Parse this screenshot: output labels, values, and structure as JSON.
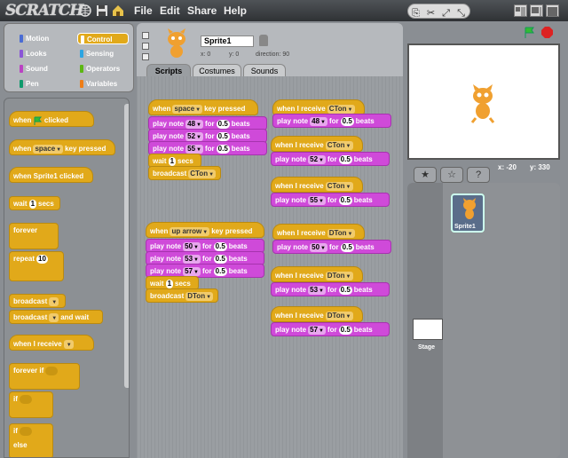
{
  "app": {
    "logo": "SCRATCH",
    "menus": [
      "File",
      "Edit",
      "Share",
      "Help"
    ]
  },
  "categories": [
    {
      "label": "Motion",
      "color": "#4a6cd4"
    },
    {
      "label": "Control",
      "color": "#e1a91a"
    },
    {
      "label": "Looks",
      "color": "#8a55d7"
    },
    {
      "label": "Sensing",
      "color": "#2ca5e2"
    },
    {
      "label": "Sound",
      "color": "#bb42c3"
    },
    {
      "label": "Operators",
      "color": "#5cb712"
    },
    {
      "label": "Pen",
      "color": "#0e9a6c"
    },
    {
      "label": "Variables",
      "color": "#ee7d16"
    }
  ],
  "palette": {
    "when_flag": [
      "when",
      "clicked"
    ],
    "when_key": [
      "when",
      "space",
      "key pressed"
    ],
    "when_sprite": "when Sprite1 clicked",
    "wait": [
      "wait",
      "1",
      "secs"
    ],
    "forever": "forever",
    "repeat": [
      "repeat",
      "10"
    ],
    "broadcast": "broadcast",
    "broadcast_wait": [
      "broadcast",
      "and wait"
    ],
    "when_receive": "when I receive",
    "forever_if": "forever if",
    "if": "if",
    "if2": "if",
    "else": "else"
  },
  "sprite": {
    "name": "Sprite1",
    "x_label": "x:",
    "x": "0",
    "y_label": "y:",
    "y": "0",
    "dir_label": "direction:",
    "dir": "90"
  },
  "tabs": [
    "Scripts",
    "Costumes",
    "Sounds"
  ],
  "scripts": {
    "s1": {
      "hat": [
        "when",
        "space",
        "key pressed"
      ],
      "notes": [
        [
          "play note",
          "48",
          "for",
          "0.5",
          "beats"
        ],
        [
          "play note",
          "52",
          "for",
          "0.5",
          "beats"
        ],
        [
          "play note",
          "55",
          "for",
          "0.5",
          "beats"
        ]
      ],
      "wait": [
        "wait",
        "1",
        "secs"
      ],
      "broadcast": [
        "broadcast",
        "CTon"
      ]
    },
    "s2": {
      "hat": [
        "when",
        "up arrow",
        "key pressed"
      ],
      "notes": [
        [
          "play note",
          "50",
          "for",
          "0.5",
          "beats"
        ],
        [
          "play note",
          "53",
          "for",
          "0.5",
          "beats"
        ],
        [
          "play note",
          "57",
          "for",
          "0.5",
          "beats"
        ]
      ],
      "wait": [
        "wait",
        "1",
        "secs"
      ],
      "broadcast": [
        "broadcast",
        "DTon"
      ]
    },
    "r": [
      {
        "hat": [
          "when I receive",
          "CTon"
        ],
        "note": [
          "play note",
          "48",
          "for",
          "0.5",
          "beats"
        ]
      },
      {
        "hat": [
          "when I receive",
          "CTon"
        ],
        "note": [
          "play note",
          "52",
          "for",
          "0.5",
          "beats"
        ]
      },
      {
        "hat": [
          "when I receive",
          "CTon"
        ],
        "note": [
          "play note",
          "55",
          "for",
          "0.5",
          "beats"
        ]
      },
      {
        "hat": [
          "when I receive",
          "DTon"
        ],
        "note": [
          "play note",
          "50",
          "for",
          "0.5",
          "beats"
        ]
      },
      {
        "hat": [
          "when I receive",
          "DTon"
        ],
        "note": [
          "play note",
          "53",
          "for",
          "0.5",
          "beats"
        ]
      },
      {
        "hat": [
          "when I receive",
          "DTon"
        ],
        "note": [
          "play note",
          "57",
          "for",
          "0.5",
          "beats"
        ]
      }
    ]
  },
  "stage": {
    "mouse_x_label": "x:",
    "mouse_x": "-20",
    "mouse_y_label": "y:",
    "mouse_y": "330"
  },
  "sprites_list": {
    "sprite_label": "Sprite1",
    "stage_label": "Stage"
  },
  "icons": [
    "globe-icon",
    "save-icon",
    "share-icon",
    "presentation-icon",
    "green-flag-icon",
    "stop-icon",
    "cat-sprite-icon"
  ]
}
